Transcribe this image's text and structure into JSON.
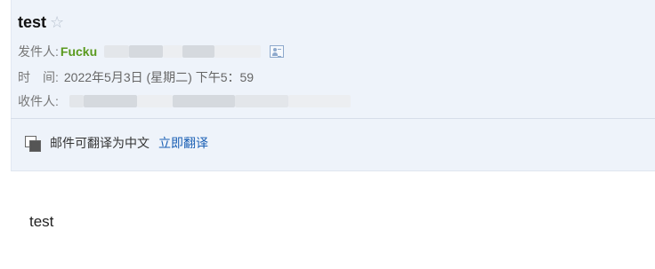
{
  "email": {
    "subject": "test",
    "star_icon": "star-outline-icon",
    "from_label": "发件人:",
    "sender_name": "Fucku",
    "time_label": "时　间:",
    "time_value": "2022年5月3日 (星期二) 下午5：59",
    "to_label": "收件人:"
  },
  "translate": {
    "icon": "translate-icon",
    "prompt": "邮件可翻译为中文",
    "action": "立即翻译"
  },
  "body": {
    "text": "test"
  }
}
